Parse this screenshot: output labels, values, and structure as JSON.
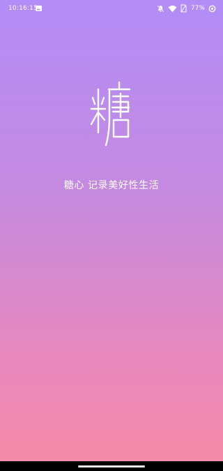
{
  "status_bar": {
    "time": "10:16:15",
    "battery_percent": "77%",
    "icons": [
      "image-icon",
      "mute-icon",
      "wifi-icon",
      "no-sim-icon",
      "battery-icon",
      "data-saver-icon"
    ]
  },
  "app": {
    "logo_icon": "tang-character-logo",
    "tagline": "糖心  记录美好性生活"
  },
  "colors": {
    "gradient_top": "#b38cf7",
    "gradient_bottom": "#f78aa6",
    "text": "#ffffff"
  }
}
